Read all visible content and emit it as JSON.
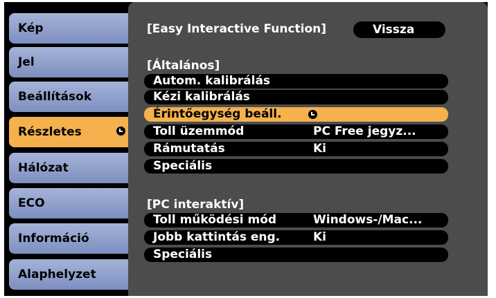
{
  "menu": {
    "tabs": [
      {
        "label": "Kép"
      },
      {
        "label": "Jel"
      },
      {
        "label": "Beállítások"
      },
      {
        "label": "Részletes"
      },
      {
        "label": "Hálózat"
      },
      {
        "label": "ECO"
      },
      {
        "label": "Információ"
      },
      {
        "label": "Alaphelyzet"
      }
    ],
    "active_tab": "Részletes"
  },
  "panel": {
    "title": "[Easy Interactive Function]",
    "back_label": "Vissza",
    "general": {
      "header": "[Általános]",
      "items": [
        {
          "label": "Autom. kalibrálás",
          "value": ""
        },
        {
          "label": "Kézi kalibrálás",
          "value": ""
        },
        {
          "label": "Érintőegység beáll.",
          "value": ""
        },
        {
          "label": "Toll üzemmód",
          "value": "PC Free jegyz..."
        },
        {
          "label": "Rámutatás",
          "value": "Ki"
        },
        {
          "label": "Speciális",
          "value": ""
        }
      ]
    },
    "pc_interactive": {
      "header": "[PC interaktív]",
      "items": [
        {
          "label": "Toll működési mód",
          "value": "Windows-/Mac..."
        },
        {
          "label": "Jobb kattintás eng.",
          "value": "Ki"
        },
        {
          "label": "Speciális",
          "value": ""
        }
      ]
    }
  },
  "colors": {
    "tab": "#8e9ecb",
    "highlight": "#f4b14d",
    "panel": "#4c4c4c",
    "background": "#000000"
  }
}
